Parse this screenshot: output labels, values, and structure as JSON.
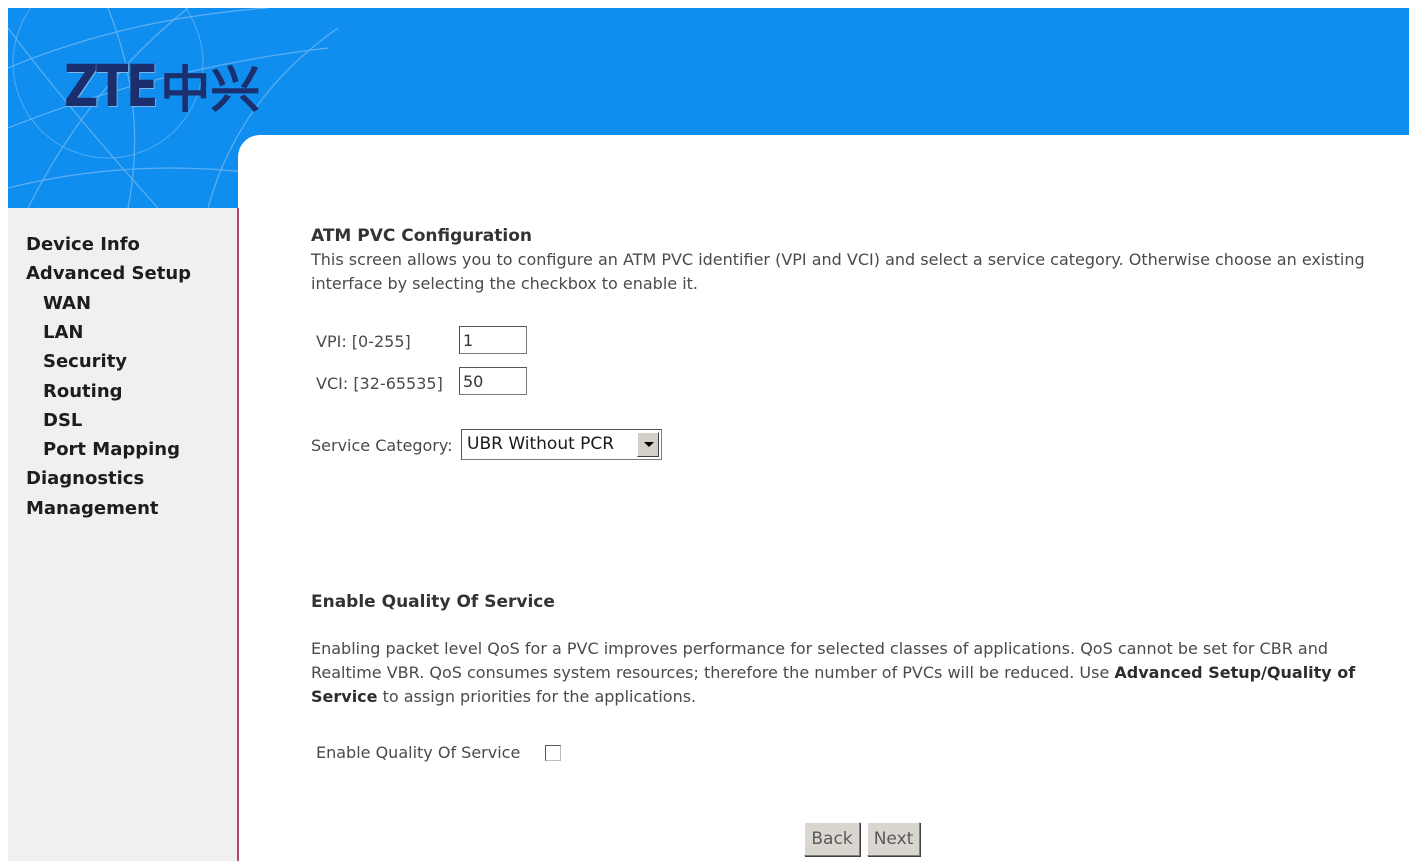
{
  "header": {
    "logo_latin": "ZTE",
    "logo_cjk": "中兴"
  },
  "sidebar": {
    "items": [
      {
        "label": "Device Info"
      },
      {
        "label": "Advanced Setup"
      },
      {
        "label": "WAN"
      },
      {
        "label": "LAN"
      },
      {
        "label": "Security"
      },
      {
        "label": "Routing"
      },
      {
        "label": "DSL"
      },
      {
        "label": "Port Mapping"
      },
      {
        "label": "Diagnostics"
      },
      {
        "label": "Management"
      }
    ]
  },
  "atm": {
    "title": "ATM PVC Configuration",
    "description": "This screen allows you to configure an ATM PVC identifier (VPI and VCI) and select a service category. Otherwise choose an existing interface by selecting the checkbox to enable it.",
    "vpi_label": "VPI: [0-255]",
    "vpi_value": "1",
    "vci_label": "VCI: [32-65535]",
    "vci_value": "50",
    "service_category_label": "Service Category:",
    "service_category_value": "UBR Without PCR"
  },
  "qos": {
    "title": "Enable Quality Of Service",
    "description_part1": "Enabling packet level QoS for a PVC improves performance for selected classes of applications.  QoS cannot be set for CBR and Realtime VBR.  QoS consumes system resources; therefore the number of PVCs will be reduced. Use ",
    "description_link": "Advanced Setup/Quality of Service",
    "description_part2": " to assign priorities for the applications.",
    "checkbox_label": "Enable Quality Of Service",
    "checked": false
  },
  "buttons": {
    "back": "Back",
    "next": "Next"
  },
  "colors": {
    "banner": "#108ef0",
    "sidebar": "#f0f0f0",
    "panel_border": "#b44a63"
  }
}
